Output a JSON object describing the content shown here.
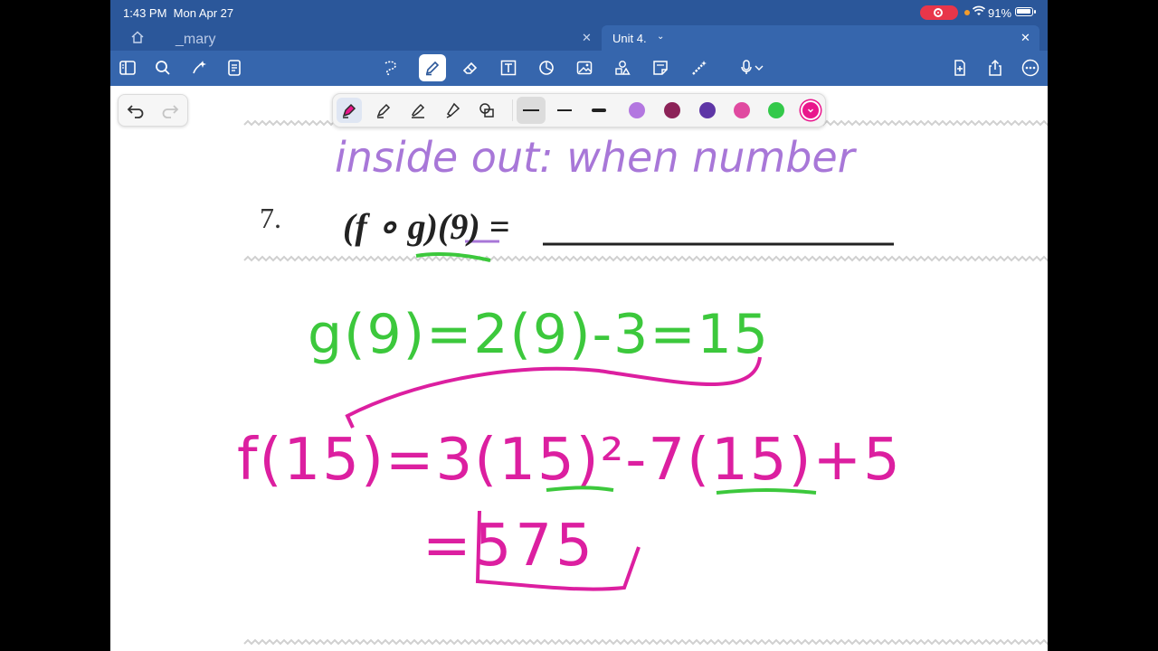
{
  "status_bar": {
    "time": "1:43 PM",
    "date": "Mon Apr 27",
    "battery": "91%"
  },
  "tabs": [
    {
      "label": "_mary"
    },
    {
      "label": "Unit 4."
    }
  ],
  "toolbar": {
    "icons": [
      "sidebar-icon",
      "search-icon",
      "sparkle-icon",
      "notes-icon",
      "lasso-icon",
      "pen-icon",
      "eraser-icon",
      "text-box-icon",
      "shapes-icon",
      "image-icon",
      "stickers-icon",
      "sticky-note-icon",
      "magic-wand-icon",
      "microphone-icon",
      "add-page-icon",
      "share-icon",
      "more-icon"
    ]
  },
  "palette": {
    "colors": [
      "#b377e0",
      "#8c2358",
      "#5e36a6",
      "#e04aa0",
      "#33c94a",
      "#e9168c"
    ]
  },
  "content": {
    "problem_number": "7.",
    "expression": "(f ∘ g)(9) =",
    "ink_top": "inside out: when number",
    "ink_line1": "g(9)=2(9)-3=15",
    "ink_line2": "f(15)=3(15)²-7(15)+5",
    "ink_line3": "=575"
  },
  "colors": {
    "header": "#2b579a",
    "toolbar": "#3666ad",
    "ink_green": "#3cc83c",
    "ink_magenta": "#dc1fa0",
    "ink_purple": "#a877d8"
  }
}
